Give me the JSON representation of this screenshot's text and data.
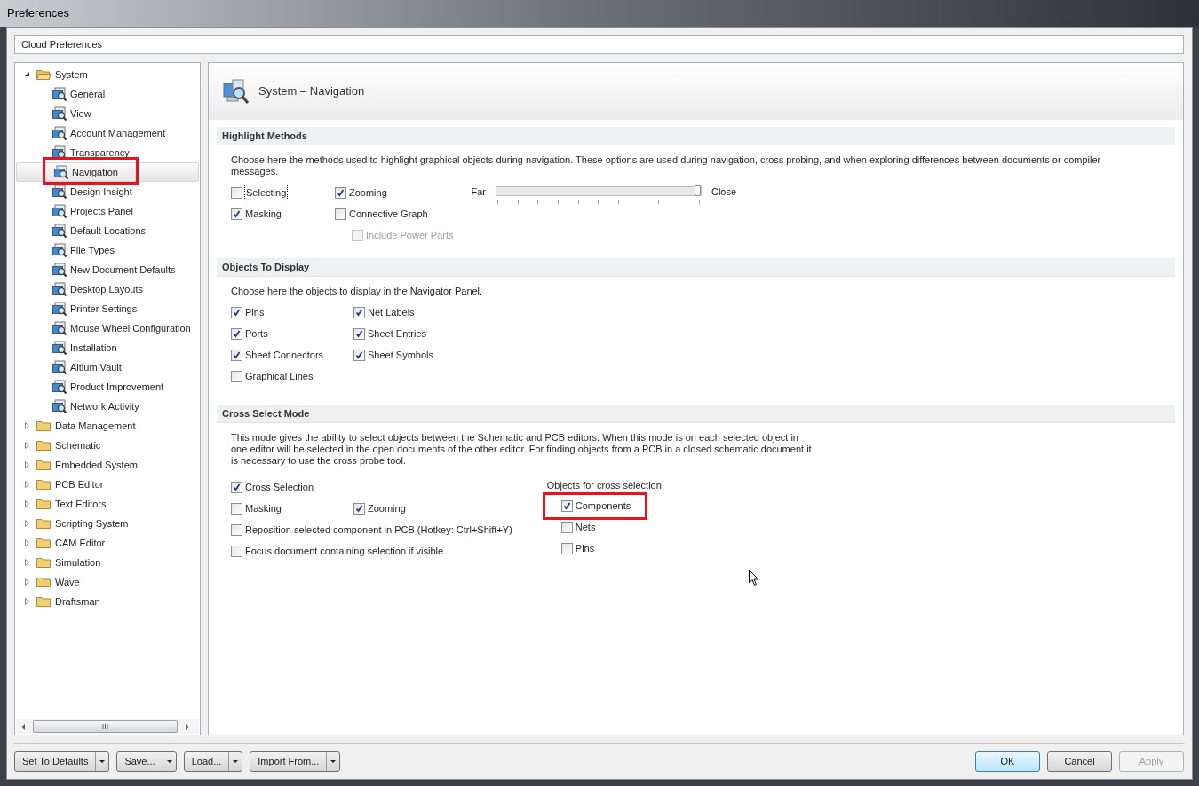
{
  "window": {
    "title": "Preferences"
  },
  "cloud_preferences": "Cloud Preferences",
  "tree": [
    {
      "label": "System",
      "expanded": true,
      "selected": false,
      "highlighted": false,
      "children": [
        {
          "label": "General",
          "selected": false,
          "highlighted": false
        },
        {
          "label": "View",
          "selected": false,
          "highlighted": false
        },
        {
          "label": "Account Management",
          "selected": false,
          "highlighted": false
        },
        {
          "label": "Transparency",
          "selected": false,
          "highlighted": false
        },
        {
          "label": "Navigation",
          "selected": true,
          "highlighted": true
        },
        {
          "label": "Design Insight",
          "selected": false,
          "highlighted": false
        },
        {
          "label": "Projects Panel",
          "selected": false,
          "highlighted": false
        },
        {
          "label": "Default Locations",
          "selected": false,
          "highlighted": false
        },
        {
          "label": "File Types",
          "selected": false,
          "highlighted": false
        },
        {
          "label": "New Document Defaults",
          "selected": false,
          "highlighted": false
        },
        {
          "label": "Desktop Layouts",
          "selected": false,
          "highlighted": false
        },
        {
          "label": "Printer Settings",
          "selected": false,
          "highlighted": false
        },
        {
          "label": "Mouse Wheel Configuration",
          "selected": false,
          "highlighted": false
        },
        {
          "label": "Installation",
          "selected": false,
          "highlighted": false
        },
        {
          "label": "Altium Vault",
          "selected": false,
          "highlighted": false
        },
        {
          "label": "Product Improvement",
          "selected": false,
          "highlighted": false
        },
        {
          "label": "Network Activity",
          "selected": false,
          "highlighted": false
        }
      ]
    },
    {
      "label": "Data Management",
      "expanded": false,
      "selected": false,
      "highlighted": false
    },
    {
      "label": "Schematic",
      "expanded": false,
      "selected": false,
      "highlighted": false
    },
    {
      "label": "Embedded System",
      "expanded": false,
      "selected": false,
      "highlighted": false
    },
    {
      "label": "PCB Editor",
      "expanded": false,
      "selected": false,
      "highlighted": false
    },
    {
      "label": "Text Editors",
      "expanded": false,
      "selected": false,
      "highlighted": false
    },
    {
      "label": "Scripting System",
      "expanded": false,
      "selected": false,
      "highlighted": false
    },
    {
      "label": "CAM Editor",
      "expanded": false,
      "selected": false,
      "highlighted": false
    },
    {
      "label": "Simulation",
      "expanded": false,
      "selected": false,
      "highlighted": false
    },
    {
      "label": "Wave",
      "expanded": false,
      "selected": false,
      "highlighted": false
    },
    {
      "label": "Draftsman",
      "expanded": false,
      "selected": false,
      "highlighted": false
    }
  ],
  "page": {
    "title": "System – Navigation",
    "sections": [
      {
        "title": "Highlight Methods",
        "description": "Choose here the methods used to highlight graphical objects during navigation. These options are used during navigation, cross probing, and when exploring differences between documents or compiler messages.",
        "rows": [
          [
            {
              "kind": "checkbox",
              "label": "Selecting",
              "checked": false,
              "focused": true
            },
            {
              "kind": "checkbox",
              "label": "Zooming",
              "checked": true,
              "focused": false
            }
          ],
          [
            {
              "kind": "checkbox",
              "label": "Masking",
              "checked": true,
              "focused": false
            },
            {
              "kind": "checkbox",
              "label": "Connective Graph",
              "checked": false,
              "focused": false
            }
          ],
          [
            {
              "kind": "sub-checkbox",
              "label": "Include Power Parts",
              "checked": false,
              "focused": false,
              "disabled": true
            }
          ]
        ],
        "slider": {
          "left_label": "Far",
          "right_label": "Close",
          "level": 1
        }
      },
      {
        "title": "Objects To Display",
        "description": "Choose here the objects to display in the Navigator Panel.",
        "rows": [
          [
            {
              "kind": "checkbox",
              "label": "Pins",
              "checked": true,
              "focused": false
            },
            {
              "kind": "checkbox",
              "label": "Net Labels",
              "checked": true,
              "focused": false
            }
          ],
          [
            {
              "kind": "checkbox",
              "label": "Ports",
              "checked": true,
              "focused": false
            },
            {
              "kind": "checkbox",
              "label": "Sheet Entries",
              "checked": true,
              "focused": false
            }
          ],
          [
            {
              "kind": "checkbox",
              "label": "Sheet Connectors",
              "checked": true,
              "focused": false
            },
            {
              "kind": "checkbox",
              "label": "Sheet Symbols",
              "checked": true,
              "focused": false
            }
          ],
          [
            {
              "kind": "checkbox",
              "label": "Graphical Lines",
              "checked": false,
              "focused": false
            }
          ]
        ]
      },
      {
        "title": "Cross Select Mode",
        "description": "This mode gives the ability to select objects between the Schematic and PCB editors.  When this mode is on each selected object in one editor will be selected in the open documents of the other editor.  For finding objects from a PCB in a closed schematic document it is necessary to use the cross probe tool.",
        "rows": [
          [
            {
              "kind": "checkbox",
              "label": "Cross Selection",
              "checked": true,
              "focused": false
            }
          ],
          [
            {
              "kind": "checkbox",
              "label": "Masking",
              "checked": false,
              "focused": false
            },
            {
              "kind": "checkbox",
              "label": "Zooming",
              "checked": true,
              "focused": false
            }
          ],
          [
            {
              "kind": "checkbox",
              "label": "Reposition selected component in PCB (Hotkey: Ctrl+Shift+Y)",
              "checked": false,
              "focused": false
            }
          ],
          [
            {
              "kind": "checkbox",
              "label": "Focus document containing selection if visible",
              "checked": false,
              "focused": false
            }
          ]
        ],
        "group": {
          "title": "Objects for cross selection",
          "items": [
            {
              "label": "Components",
              "checked": true,
              "highlighted": true
            },
            {
              "label": "Nets",
              "checked": false,
              "highlighted": false
            },
            {
              "label": "Pins",
              "checked": false,
              "highlighted": false
            }
          ]
        }
      }
    ]
  },
  "left_buttons": [
    "Set To Defaults",
    "Save...",
    "Load...",
    "Import From..."
  ],
  "right_buttons": [
    {
      "label": "OK",
      "default": true,
      "disabled": false
    },
    {
      "label": "Cancel",
      "default": false,
      "disabled": false
    },
    {
      "label": "Apply",
      "default": false,
      "disabled": true
    }
  ]
}
